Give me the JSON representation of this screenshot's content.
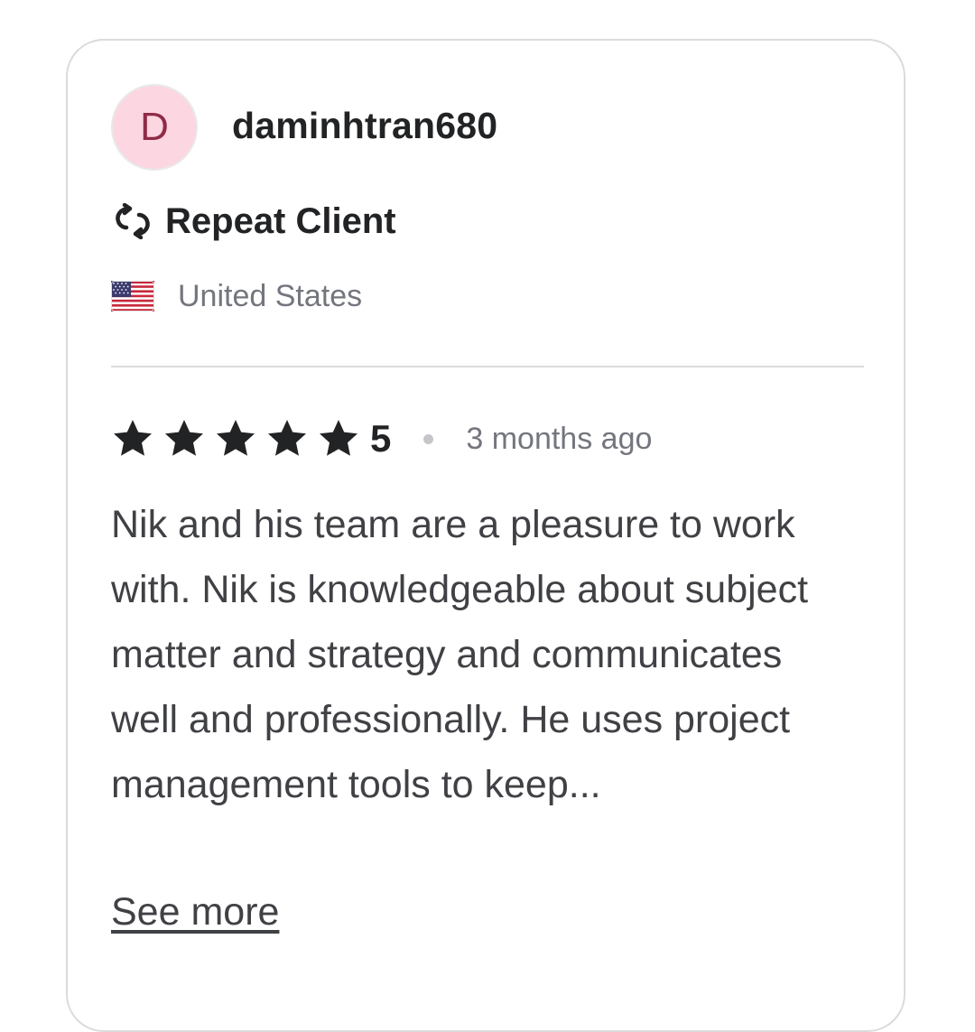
{
  "review": {
    "avatar_initial": "D",
    "username": "daminhtran680",
    "repeat_client_label": "Repeat Client",
    "country": "United States",
    "rating": "5",
    "stars_filled": 5,
    "time_ago": "3 months ago",
    "text": "Nik and his team are a pleasure to work with. Nik is knowledgeable about subject matter and strategy and communicates well and professionally. He uses project management tools to keep...",
    "see_more_label": "See more"
  },
  "icons": {
    "repeat": "repeat-client-icon",
    "flag": "us-flag-icon",
    "star": "star-icon"
  },
  "colors": {
    "avatar_bg": "#fcd6e1",
    "avatar_text": "#8f2b47",
    "primary_text": "#222325",
    "secondary_text": "#74767e",
    "body_text": "#404145",
    "border": "#dadbdd"
  }
}
